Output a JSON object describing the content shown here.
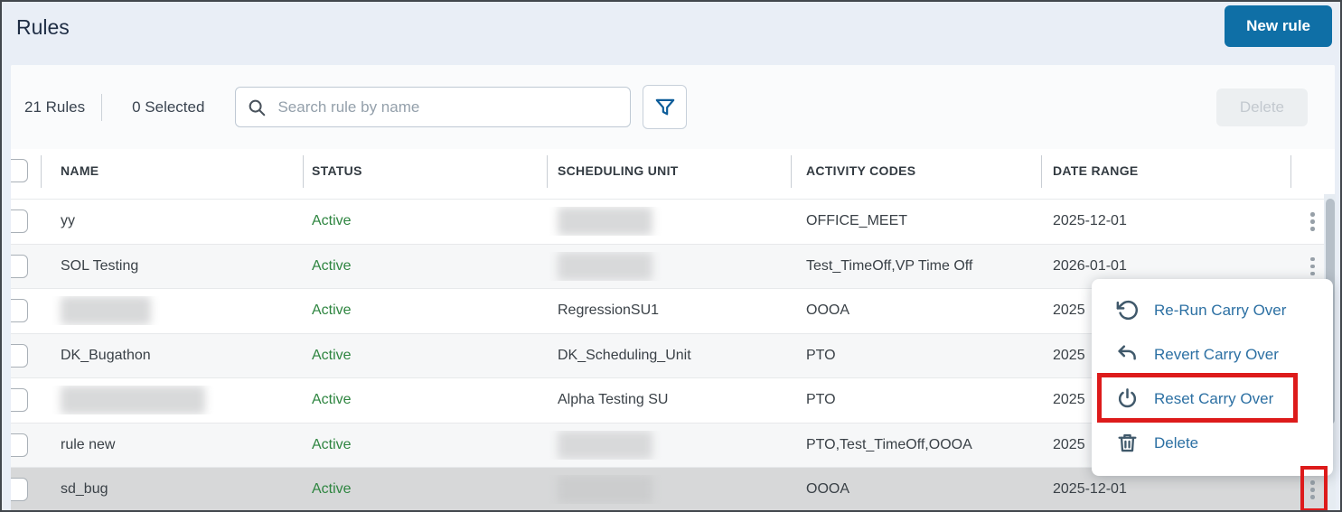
{
  "title": "Rules",
  "actions": {
    "new_rule_label": "New rule",
    "delete_label": "Delete"
  },
  "toolbar": {
    "rules_count": "21 Rules",
    "selected_count": "0 Selected",
    "search_placeholder": "Search rule by name"
  },
  "table": {
    "headers": {
      "name": "NAME",
      "status": "STATUS",
      "scheduling_unit": "SCHEDULING UNIT",
      "activity_codes": "ACTIVITY CODES",
      "date_range": "DATE RANGE"
    },
    "rows": [
      {
        "name": "yy",
        "status": "Active",
        "scheduling_unit": "",
        "scheduling_unit_blurred": true,
        "activity_codes": "OFFICE_MEET",
        "date_range": "2025-12-01",
        "selected": false
      },
      {
        "name": "SOL Testing",
        "status": "Active",
        "scheduling_unit": "",
        "scheduling_unit_blurred": true,
        "activity_codes": "Test_TimeOff,VP Time Off",
        "date_range": "2026-01-01",
        "selected": false
      },
      {
        "name": "",
        "name_blurred": true,
        "status": "Active",
        "scheduling_unit": "RegressionSU1",
        "activity_codes": "OOOA",
        "date_range": "2025",
        "date_clipped_by_menu": true,
        "selected": false
      },
      {
        "name": "DK_Bugathon",
        "status": "Active",
        "scheduling_unit": "DK_Scheduling_Unit",
        "activity_codes": "PTO",
        "date_range": "2025",
        "date_clipped_by_menu": true,
        "selected": false
      },
      {
        "name": "",
        "name_blurred": true,
        "status": "Active",
        "scheduling_unit": "Alpha Testing SU",
        "activity_codes": "PTO",
        "date_range": "2025",
        "date_clipped_by_menu": true,
        "selected": false
      },
      {
        "name": "rule new",
        "status": "Active",
        "scheduling_unit": "",
        "scheduling_unit_blurred": true,
        "activity_codes": "PTO,Test_TimeOff,OOOA",
        "date_range": "2025",
        "date_clipped_by_menu": true,
        "selected": false
      },
      {
        "name": "sd_bug",
        "status": "Active",
        "scheduling_unit": "",
        "scheduling_unit_blurred": true,
        "activity_codes": "OOOA",
        "date_range": "2025-12-01",
        "selected": true
      }
    ]
  },
  "context_menu": {
    "items": [
      {
        "label": "Re-Run Carry Over",
        "icon": "rerun-carry-over-icon"
      },
      {
        "label": "Revert Carry Over",
        "icon": "revert-carry-over-icon"
      },
      {
        "label": "Reset Carry Over",
        "icon": "reset-power-icon",
        "highlighted_by_annotation": true
      },
      {
        "label": "Delete",
        "icon": "trash-icon"
      }
    ]
  },
  "annotations": {
    "highlighted_menu_item": "Reset Carry Over",
    "highlighted_row_kebab": "sd_bug"
  },
  "colors": {
    "accent_blue": "#0f6fa6",
    "active_green": "#2e8540",
    "menu_link_blue": "#2c70a3",
    "annotation_red": "#dd1b1b",
    "page_background": "#e9eef6"
  }
}
